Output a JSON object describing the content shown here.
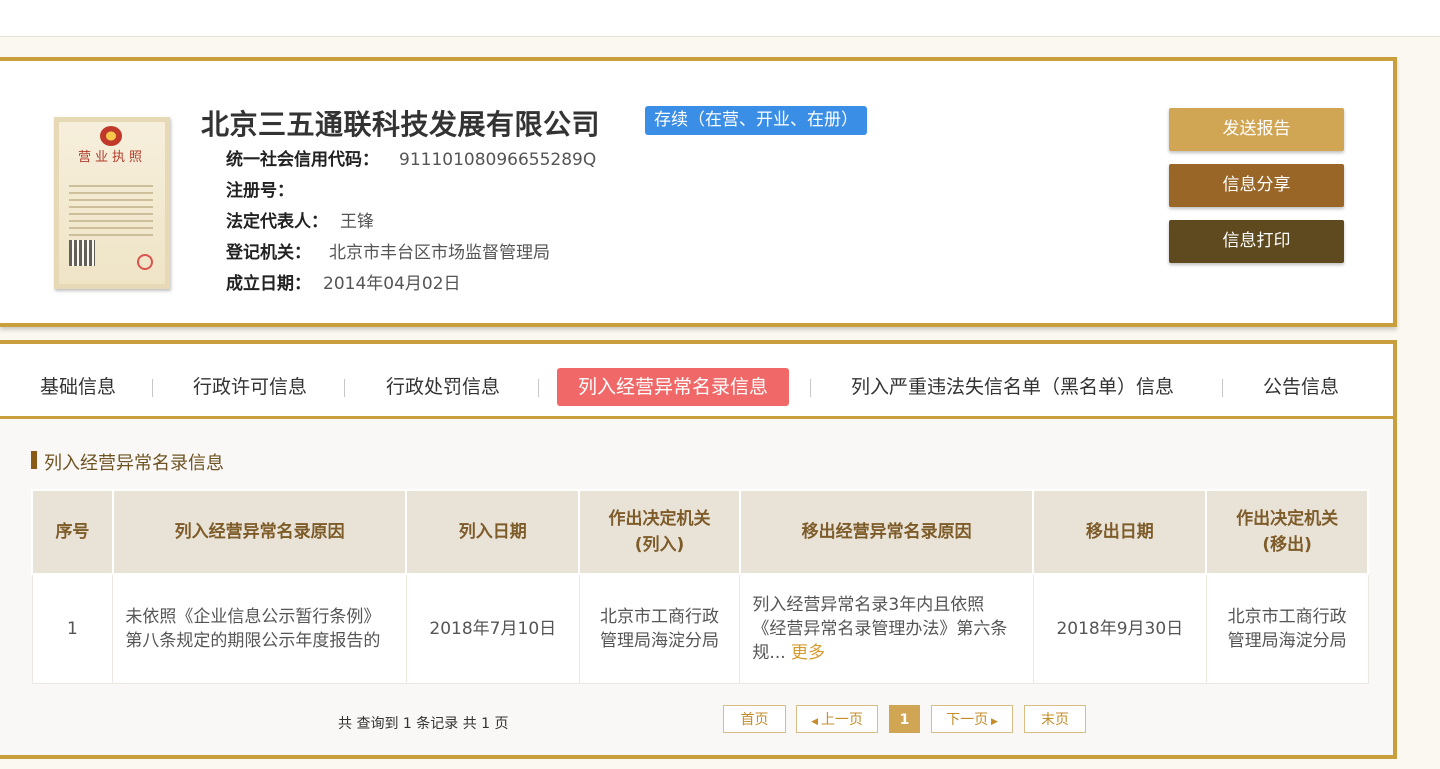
{
  "company": {
    "name": "北京三五通联科技发展有限公司",
    "status": "存续（在营、开业、在册）",
    "license_title": "营业执照",
    "fields": [
      {
        "label": "统一社会信用代码：",
        "value": "91110108096655289Q"
      },
      {
        "label": "注册号：",
        "value": ""
      },
      {
        "label": "法定代表人：",
        "value": "王锋"
      },
      {
        "label": "登记机关：",
        "value": "北京市丰台区市场监督管理局"
      },
      {
        "label": "成立日期：",
        "value": "2014年04月02日"
      }
    ]
  },
  "actions": {
    "report": "发送报告",
    "share": "信息分享",
    "print": "信息打印"
  },
  "tabs": [
    {
      "label": "基础信息"
    },
    {
      "label": "行政许可信息"
    },
    {
      "label": "行政处罚信息"
    },
    {
      "label": "列入经营异常名录信息",
      "active": true
    },
    {
      "label": "列入严重违法失信名单（黑名单）信息"
    },
    {
      "label": "公告信息"
    }
  ],
  "section": {
    "title": "列入经营异常名录信息"
  },
  "table": {
    "headers": [
      "序号",
      "列入经营异常名录原因",
      "列入日期",
      "作出决定机关(列入)",
      "移出经营异常名录原因",
      "移出日期",
      "作出决定机关(移出)"
    ],
    "header_lines": {
      "h3a": "作出决定机关",
      "h3b": "(列入)",
      "h6a": "作出决定机关",
      "h6b": "(移出)"
    },
    "rows": [
      {
        "no": "1",
        "reason_in_1": "未依照《企业信息公示暂行条例》",
        "reason_in_2": "第八条规定的期限公示年度报告的",
        "date_in": "2018年7月10日",
        "authority_in_1": "北京市工商行政",
        "authority_in_2": "管理局海淀分局",
        "reason_out_1": "列入经营异常名录3年内且依照",
        "reason_out_2": "《经营异常名录管理办法》第六条",
        "reason_out_3": "规...",
        "more": "更多",
        "date_out": "2018年9月30日",
        "authority_out_1": "北京市工商行政",
        "authority_out_2": "管理局海淀分局"
      }
    ]
  },
  "pagination": {
    "summary": "共 查询到 1 条记录 共 1 页",
    "first": "首页",
    "prev": "上一页",
    "current": "1",
    "next": "下一页",
    "last": "末页"
  },
  "colors": {
    "gold_border": "#c99f3e",
    "status_blue": "#3a8ee6",
    "active_tab": "#f06868",
    "btn_report": "#d0a553",
    "btn_share": "#9a6627",
    "btn_print": "#5e4a1e"
  }
}
